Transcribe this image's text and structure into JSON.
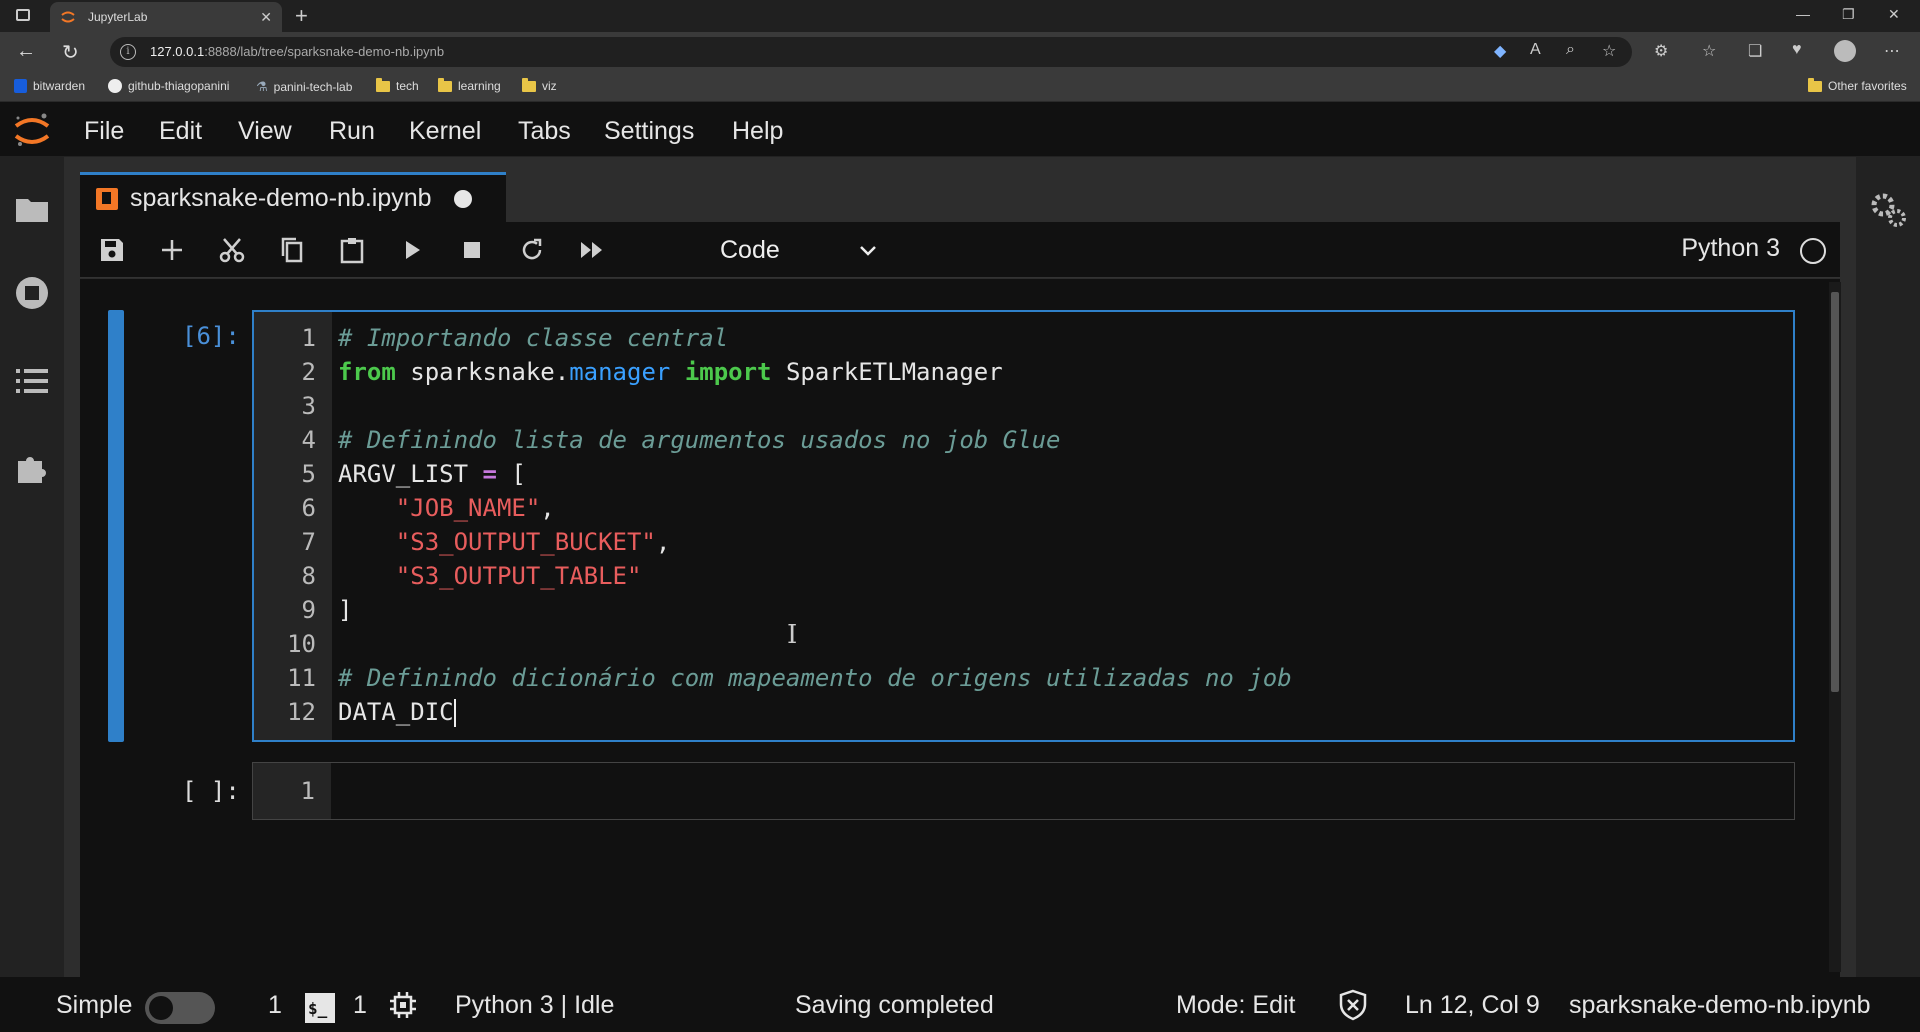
{
  "browser": {
    "tab_title": "JupyterLab",
    "url_host": "127.0.0.1",
    "url_rest": ":8888/lab/tree/sparksnake-demo-nb.ipynb",
    "bookmarks": [
      "bitwarden",
      "github-thiagopanini",
      "panini-tech-lab",
      "tech",
      "learning",
      "viz"
    ],
    "other_favorites": "Other favorites"
  },
  "menu": [
    "File",
    "Edit",
    "View",
    "Run",
    "Kernel",
    "Tabs",
    "Settings",
    "Help"
  ],
  "notebook": {
    "tab_title": "sparksnake-demo-nb.ipynb",
    "cell_type": "Code",
    "kernel_name": "Python 3",
    "cell1_prompt": "[6]:",
    "cell2_prompt": "[ ]:",
    "line_numbers": [
      "1",
      "2",
      "3",
      "4",
      "5",
      "6",
      "7",
      "8",
      "9",
      "10",
      "11",
      "12"
    ],
    "code": {
      "l1": "# Importando classe central",
      "l2_kw1": "from",
      "l2_mod1": "sparksnake.",
      "l2_mod2": "manager",
      "l2_kw2": "import",
      "l2_cls": "SparkETLManager",
      "l4": "# Definindo lista de argumentos usados no job Glue",
      "l5_var": "ARGV_LIST",
      "l5_op": "=",
      "l5_br": "[",
      "l6": "\"JOB_NAME\"",
      "l7": "\"S3_OUTPUT_BUCKET\"",
      "l8": "\"S3_OUTPUT_TABLE\"",
      "l9": "]",
      "l11": "# Definindo dicionário com mapeamento de origens utilizadas no job",
      "l12": "DATA_DIC",
      "comma": ","
    },
    "cell2_line": "1"
  },
  "status": {
    "mode_label": "Simple",
    "count1": "1",
    "count2": "1",
    "kernel_status": "Python 3 | Idle",
    "saving": "Saving completed",
    "mode": "Mode: Edit",
    "position": "Ln 12, Col 9",
    "filename": "sparksnake-demo-nb.ipynb"
  }
}
